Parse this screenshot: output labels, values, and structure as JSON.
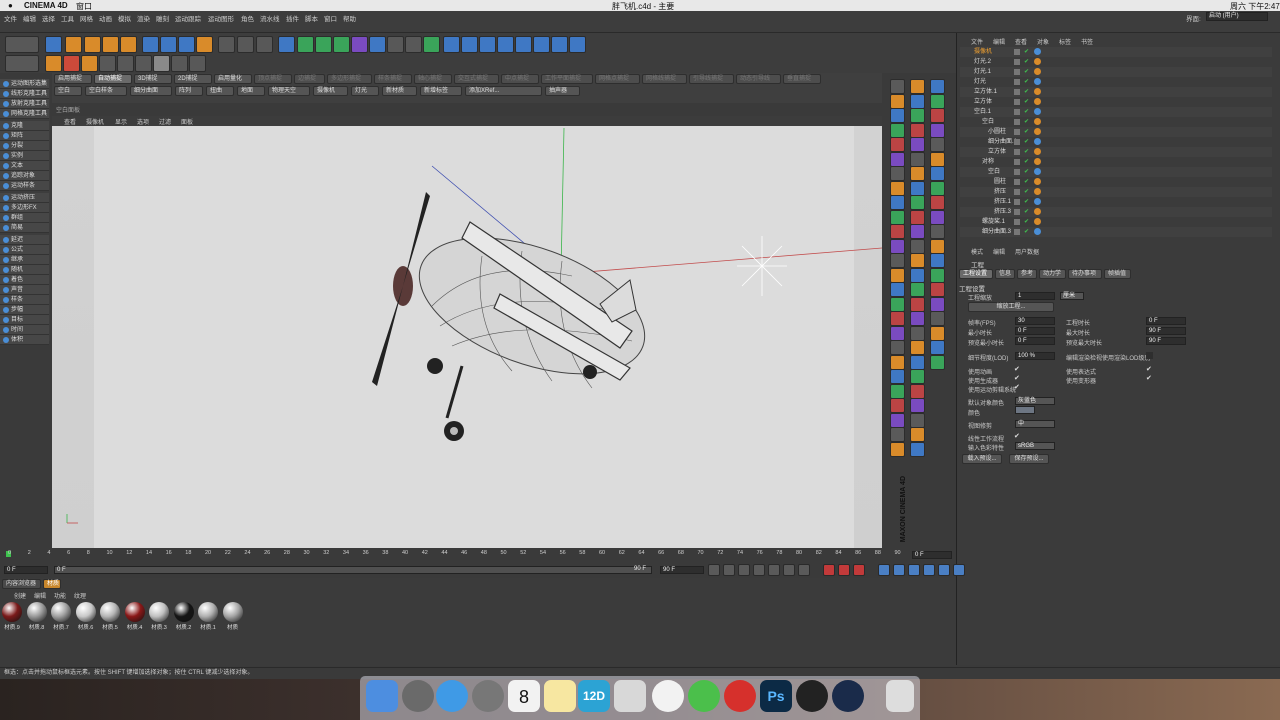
{
  "mac": {
    "app": "CINEMA 4D",
    "menu": "窗口",
    "title": "胖飞机.c4d - 主要",
    "clock": "周六 下午2:47"
  },
  "app_menu": [
    "文件",
    "编辑",
    "选择",
    "工具",
    "网格",
    "动画",
    "模拟",
    "渲染",
    "雕刻",
    "运动跟踪",
    "运动图形",
    "角色",
    "流水线",
    "插件",
    "脚本",
    "窗口",
    "帮助"
  ],
  "layout_label": "界面:",
  "layout_value": "启动 (用户)",
  "render_row": [
    "启用捕捉",
    "自动捕捉",
    "3D捕捉",
    "2D捕捉",
    "启用量化",
    "顶点捕捉",
    "边捕捉",
    "多边形捕捉",
    "样条捕捉",
    "轴心捕捉",
    "交互式捕捉",
    "中点捕捉",
    "工作平面捕捉",
    "网格点捕捉",
    "网格线捕捉",
    "引导线捕捉",
    "动态引导线",
    "垂直捕捉"
  ],
  "obj_row": [
    "空白",
    "空白样条",
    "细分曲面",
    "阵列",
    "扭曲",
    "地面",
    "物理天空",
    "摄像机",
    "灯光",
    "新材质",
    "新增标签",
    "添加XRef...",
    "抽声器"
  ],
  "side_tools": [
    "运动图形选集",
    "线形克隆工具",
    "放射克隆工具",
    "网格克隆工具",
    "克隆",
    "矩阵",
    "分裂",
    "实例",
    "文本",
    "追踪对象",
    "运动样条",
    "运动挤压",
    "多边形FX",
    "群组",
    "简易",
    "延迟",
    "公式",
    "继承",
    "随机",
    "着色",
    "声音",
    "样条",
    "步幅",
    "目标",
    "时间",
    "体积"
  ],
  "viewport": {
    "title": "空白面板",
    "menu": [
      "查看",
      "摄像机",
      "显示",
      "选项",
      "过滤",
      "面板"
    ],
    "brand": "MAXON CINEMA 4D"
  },
  "timeline": {
    "ticks": [
      "0",
      "2",
      "4",
      "6",
      "8",
      "10",
      "12",
      "14",
      "16",
      "18",
      "20",
      "22",
      "24",
      "26",
      "28",
      "30",
      "32",
      "34",
      "36",
      "38",
      "40",
      "42",
      "44",
      "46",
      "48",
      "50",
      "52",
      "54",
      "56",
      "58",
      "60",
      "62",
      "64",
      "66",
      "68",
      "70",
      "72",
      "74",
      "76",
      "78",
      "80",
      "82",
      "84",
      "86",
      "88",
      "90"
    ],
    "end": "0 F",
    "start": "0 F",
    "cur": "0 F",
    "max": "90 F",
    "max2": "90 F"
  },
  "content_tabs": [
    "内容浏览器",
    "材质"
  ],
  "mat_menu": [
    "创建",
    "编辑",
    "功能",
    "纹理"
  ],
  "materials": [
    {
      "name": "材质.9",
      "color": "#7a1a1a"
    },
    {
      "name": "材质.8",
      "color": "#9a9a9a"
    },
    {
      "name": "材质.7",
      "color": "#a0a0a0"
    },
    {
      "name": "材质.6",
      "color": "#c8c8c8"
    },
    {
      "name": "材质.5",
      "color": "#b5b5b5"
    },
    {
      "name": "材质.4",
      "color": "#8a1818"
    },
    {
      "name": "材质.3",
      "color": "#c0c0c0"
    },
    {
      "name": "材质.2",
      "color": "#151515"
    },
    {
      "name": "材质.1",
      "color": "#b0b0b0"
    },
    {
      "name": "材质",
      "color": "#a5a5a5"
    }
  ],
  "status": "框选：点击并拖动鼠标框选元素。按住 SHIFT 键增加选择对象；按住 CTRL 键减少选择对象。",
  "om_menu": [
    "文件",
    "编辑",
    "查看",
    "对象",
    "标签",
    "书签"
  ],
  "objects": [
    "摄像机",
    "灯光.2",
    "灯光.1",
    "灯光",
    "立方体.1",
    "立方体",
    "空白.1",
    "空白",
    "小圆柱",
    "细分曲面.1",
    "立方体",
    "对称",
    "空白",
    "圆柱",
    "挤压",
    "挤压.1",
    "挤压.3",
    "螺旋桨.1",
    "细分曲面.3"
  ],
  "attr_menu": [
    "模式",
    "编辑",
    "用户数据"
  ],
  "attr": {
    "title": "工程",
    "tabs": [
      "工程设置",
      "信息",
      "参考",
      "动力学",
      "待办事项",
      "帧插值"
    ],
    "section": "工程设置",
    "scale_label": "工程缩放",
    "scale_val": "1",
    "scale_unit": "厘米",
    "scale_btn": "缩放工程...",
    "fps_label": "帧率(FPS)",
    "fps": "30",
    "len_label": "工程时长",
    "len": "0 F",
    "min_label": "最小时长",
    "min": "0 F",
    "max_label": "最大时长",
    "max": "90 F",
    "pmin_label": "预览最小时长",
    "pmin": "0 F",
    "pmax_label": "预览最大时长",
    "pmax": "90 F",
    "lod_label": "细节程度(LOD)",
    "lod": "100 %",
    "lod2": "编辑渲染检视使用渲染LOD级别",
    "anim": "使用动画",
    "expr": "使用表达式",
    "gen": "使用生成器",
    "deform": "使用变形器",
    "motion": "使用运动剪辑系统",
    "objcolor_label": "默认对象颜色",
    "objcolor": "灰蓝色",
    "color_label": "颜色",
    "view_label": "视图修剪",
    "view": "中",
    "linear": "线性工作流程",
    "input": "输入色彩特性",
    "input_val": "sRGB",
    "load": "载入预设...",
    "save": "保存预设..."
  }
}
